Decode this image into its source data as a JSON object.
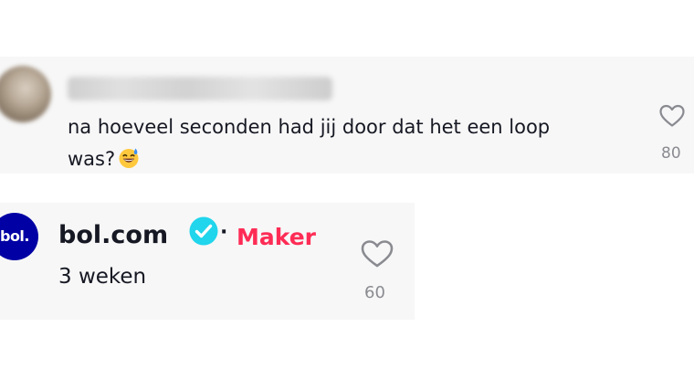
{
  "comment": {
    "text_line1": "na hoeveel seconden had jij door dat het een loop",
    "text_line2": "was?",
    "emoji": "grinning-face-with-sweat-emoji",
    "like_count": "80"
  },
  "reply": {
    "author_logo_text": "bol.",
    "author": "bol.com",
    "separator": "·",
    "badge": "Maker",
    "timestamp": "3 weken",
    "like_count": "60"
  },
  "colors": {
    "card_background": "#f7f7f7",
    "text": "#161823",
    "muted": "#8a8b91",
    "maker_badge": "#fe2c55",
    "verified_badge": "#20d5ec",
    "bol_brand": "#0000a4"
  },
  "icons": [
    "heart-outline-icon",
    "verified-check-icon"
  ]
}
